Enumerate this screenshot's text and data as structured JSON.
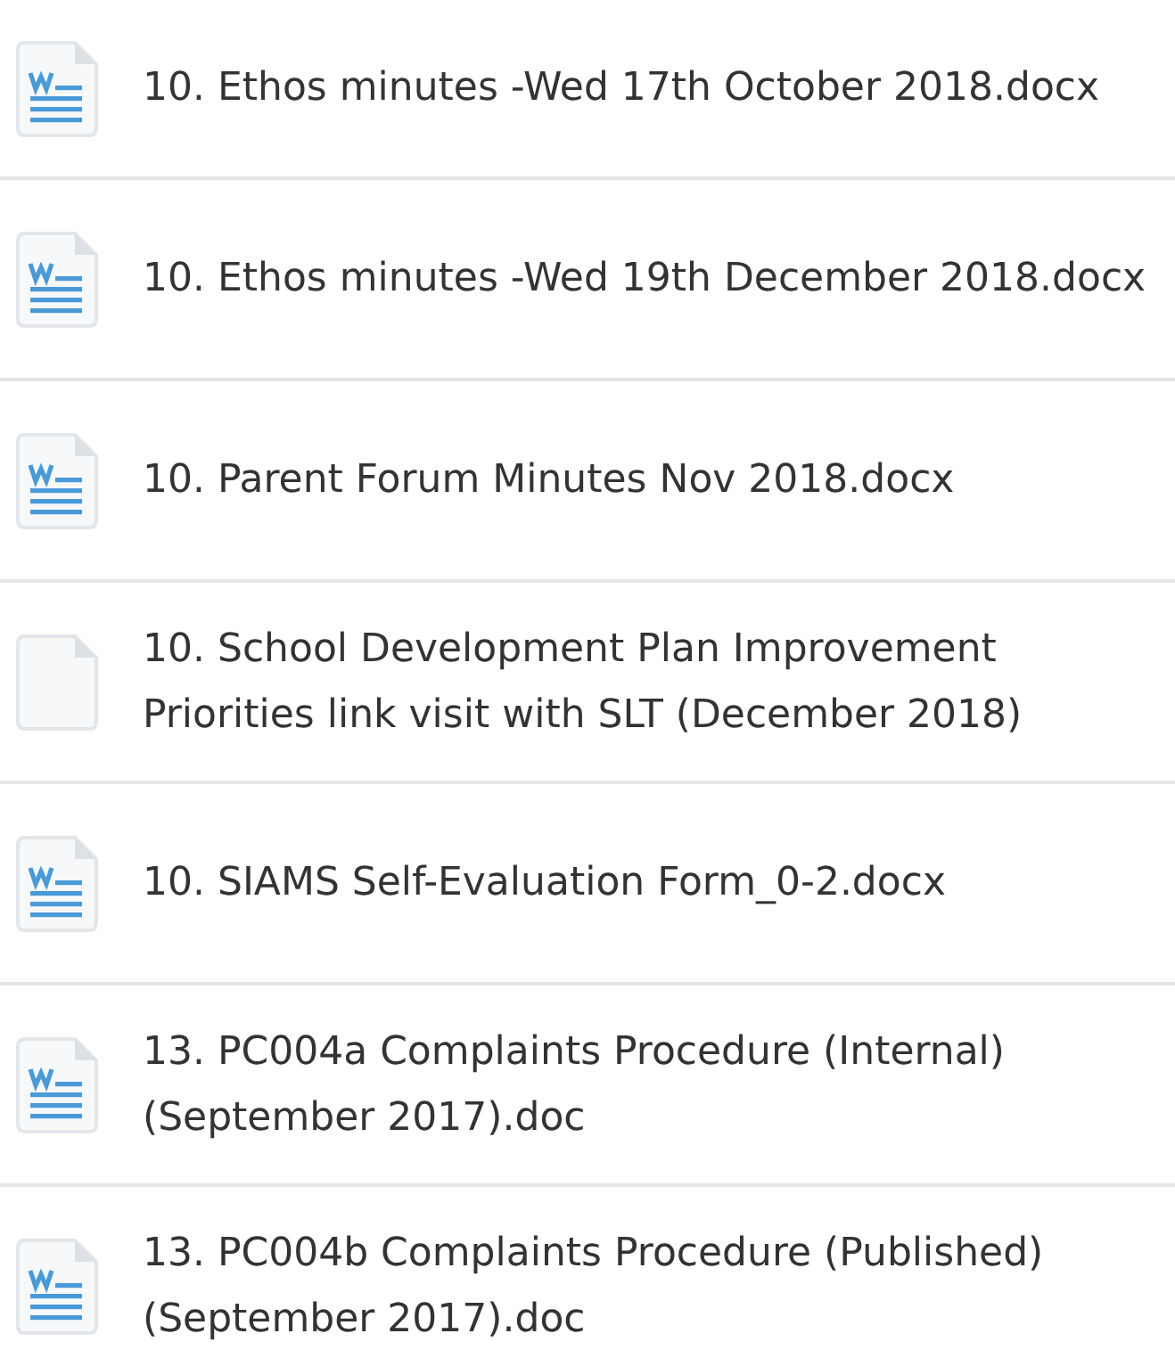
{
  "files": [
    {
      "name": "10. Ethos minutes -Wed 17th October 2018.docx",
      "kind": "word"
    },
    {
      "name": "10. Ethos minutes -Wed 19th December 2018.docx",
      "kind": "word"
    },
    {
      "name": "10. Parent Forum Minutes Nov 2018.docx",
      "kind": "word"
    },
    {
      "name": "10. School Development Plan Improvement Priorities link visit with SLT (December 2018)",
      "kind": "blank"
    },
    {
      "name": "10. SIAMS Self-Evaluation Form_0-2.docx",
      "kind": "word"
    },
    {
      "name": "13. PC004a Complaints Procedure (Internal) (September 2017).doc",
      "kind": "word"
    },
    {
      "name": "13. PC004b Complaints Procedure (Published) (September 2017).doc",
      "kind": "word"
    }
  ]
}
